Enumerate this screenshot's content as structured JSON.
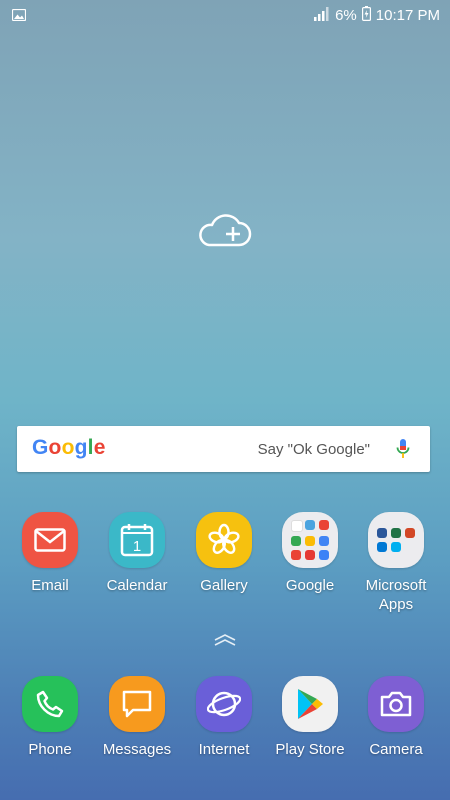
{
  "status_bar": {
    "left_icon": "image-icon",
    "signal_icon": "signal-icon",
    "battery_percent": "6%",
    "battery_icon": "battery-charging-icon",
    "time": "10:17 PM"
  },
  "widget": {
    "icon": "cloud-add-icon"
  },
  "search": {
    "logo_letters": [
      "G",
      "o",
      "o",
      "g",
      "l",
      "e"
    ],
    "logo_colors": [
      "#4285F4",
      "#EA4335",
      "#FBBC05",
      "#4285F4",
      "#34A853",
      "#EA4335"
    ],
    "hint": "Say \"Ok Google\"",
    "mic_icon": "microphone-icon"
  },
  "apps": [
    {
      "label": "Email",
      "icon": "email-icon",
      "color": "#ef5443"
    },
    {
      "label": "Calendar",
      "icon": "calendar-icon",
      "color": "#3bb8c8",
      "calendar_day": "1"
    },
    {
      "label": "Gallery",
      "icon": "gallery-flower-icon",
      "color": "#f6c10f"
    },
    {
      "label": "Google",
      "icon": "google-folder-icon",
      "color": "#ececef"
    },
    {
      "label": "Microsoft\nApps",
      "icon": "microsoft-folder-icon",
      "color": "#ececef"
    }
  ],
  "dock": [
    {
      "label": "Phone",
      "icon": "phone-icon",
      "color": "#26c15a"
    },
    {
      "label": "Messages",
      "icon": "messages-icon",
      "color": "#f79a1e"
    },
    {
      "label": "Internet",
      "icon": "internet-icon",
      "color": "#6a5fd8"
    },
    {
      "label": "Play Store",
      "icon": "play-store-icon",
      "color": "#f1f1f1"
    },
    {
      "label": "Camera",
      "icon": "camera-icon",
      "color": "#7e5fd3"
    }
  ],
  "app_drawer_icon": "chevron-up-icon"
}
